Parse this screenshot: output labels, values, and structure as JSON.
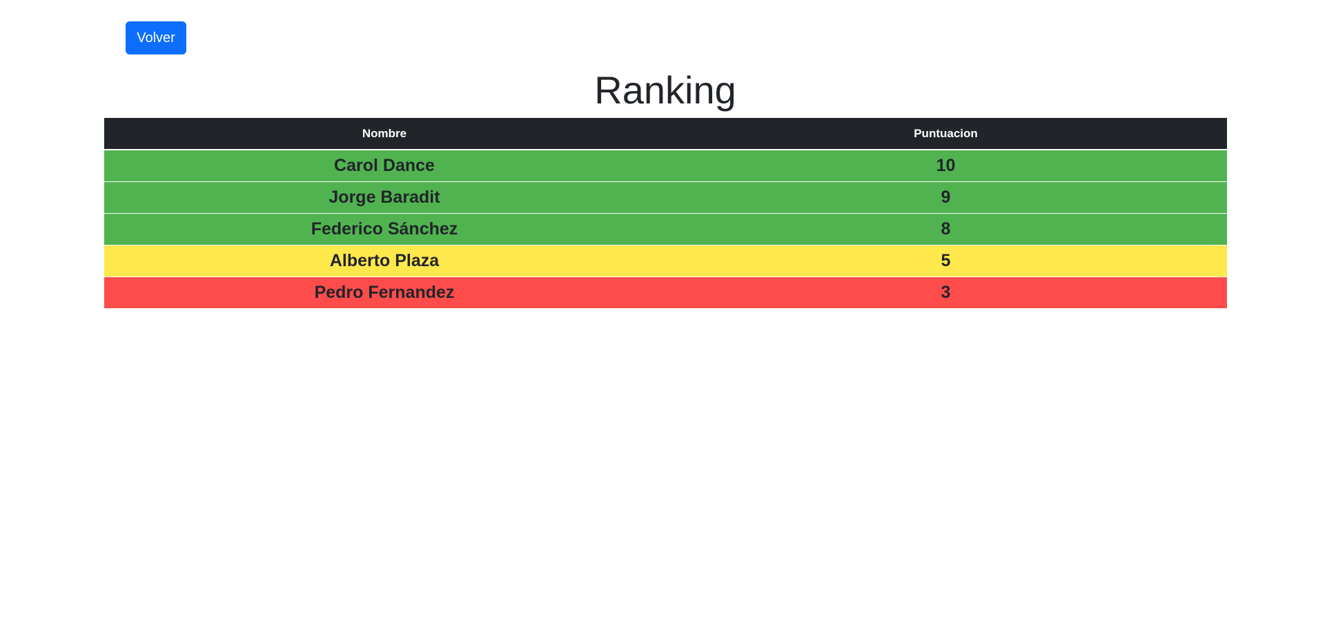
{
  "toolbar": {
    "back_label": "Volver",
    "back_color": "#0d6efd"
  },
  "page": {
    "title": "Ranking"
  },
  "table": {
    "columns": [
      "Nombre",
      "Puntuacion"
    ],
    "header_color": "#212529",
    "rows": [
      {
        "nombre": "Carol Dance",
        "puntuacion": "10",
        "color": "#51b350"
      },
      {
        "nombre": "Jorge Baradit",
        "puntuacion": "9",
        "color": "#51b350"
      },
      {
        "nombre": "Federico Sánchez",
        "puntuacion": "8",
        "color": "#51b350"
      },
      {
        "nombre": "Alberto Plaza",
        "puntuacion": "5",
        "color": "#ffe84b"
      },
      {
        "nombre": "Pedro Fernandez",
        "puntuacion": "3",
        "color": "#fe4c4c"
      }
    ]
  }
}
